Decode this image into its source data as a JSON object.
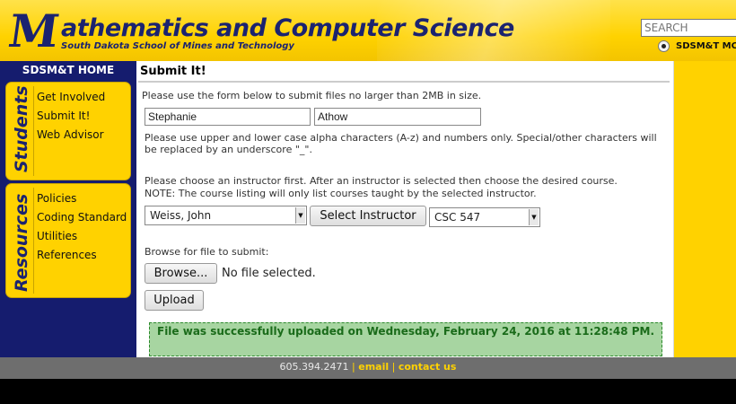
{
  "header": {
    "logo_letter": "M",
    "title": "athematics and Computer Science",
    "subtitle": "South Dakota School of Mines and Technology",
    "search_placeholder": "SEARCH",
    "radio_label": "SDSM&T MC",
    "colors": {
      "navy": "#1b2370",
      "gold": "#ffd200"
    }
  },
  "nav": {
    "home": "SDSM&T HOME",
    "students": {
      "label": "Students",
      "items": [
        "Get Involved",
        "Submit It!",
        "Web Advisor"
      ]
    },
    "resources": {
      "label": "Resources",
      "items": [
        "Policies",
        "Coding Standard",
        "Utilities",
        "References"
      ]
    }
  },
  "main": {
    "title": "Submit It!",
    "intro": "Please use the form below to submit files no larger than 2MB in size.",
    "first_name": "Stephanie",
    "last_name": "Athow",
    "name_note_1": "Please use upper and lower case alpha characters (A-z) and numbers only. Special/other characters will",
    "name_note_2": "be replaced by an underscore \"_\".",
    "instructor_note_1": "Please choose an instructor first. After an instructor is selected then choose the desired course.",
    "instructor_note_2": "NOTE: The course listing will only list courses taught by the selected instructor.",
    "instructor_selected": "Weiss, John",
    "select_instructor_button": "Select Instructor",
    "course_selected": "CSC 547",
    "browse_label": "Browse for file to submit:",
    "browse_button": "Browse...",
    "file_status": "No file selected.",
    "upload_button": "Upload",
    "success_message": "File was successfully uploaded on Wednesday, February 24, 2016 at 11:28:48 PM."
  },
  "footer": {
    "phone": "605.394.2471",
    "separator": "|",
    "email_link": "email",
    "contact_link": "contact us"
  }
}
